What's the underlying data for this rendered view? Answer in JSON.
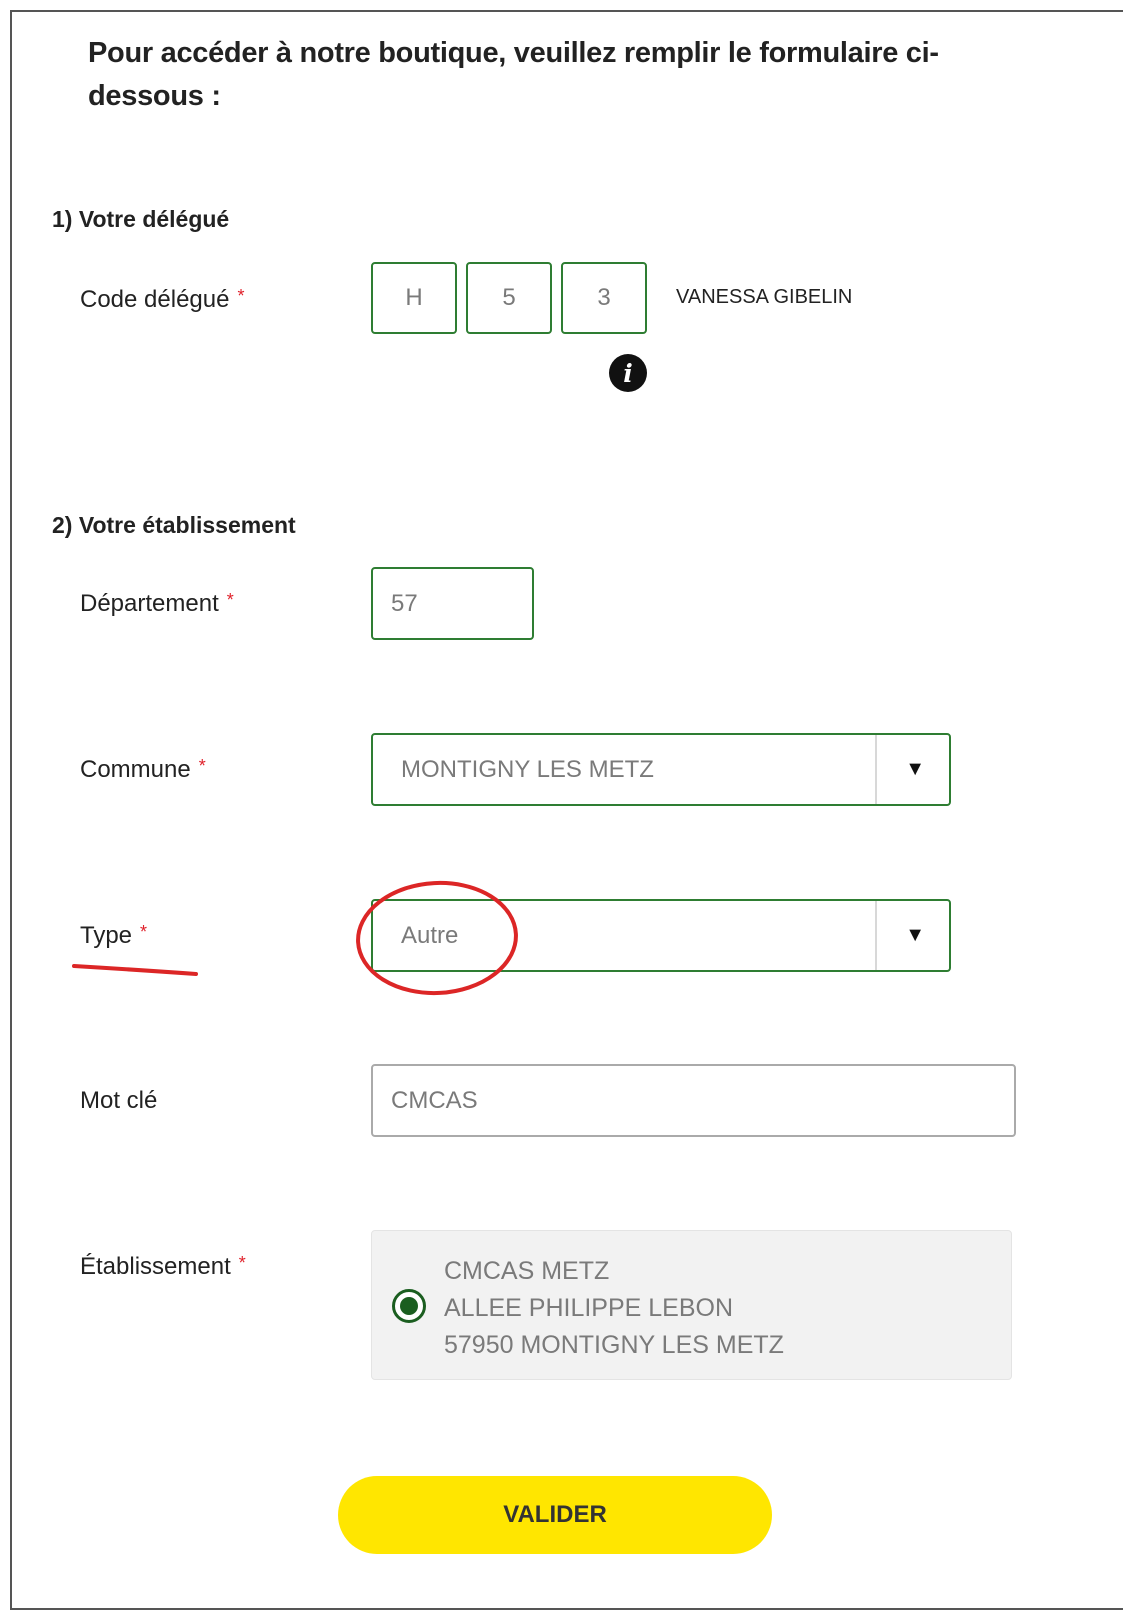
{
  "intro_text": "Pour accéder à notre boutique, veuillez remplir le formulaire ci-dessous :",
  "section1": {
    "title": "1) Votre délégué"
  },
  "delegate": {
    "label": "Code délégué",
    "required_mark": "*",
    "code_chars": [
      "H",
      "5",
      "3"
    ],
    "name": "VANESSA GIBELIN",
    "info_icon": "i"
  },
  "section2": {
    "title": "2) Votre établissement"
  },
  "departement": {
    "label": "Département",
    "required_mark": "*",
    "value": "57"
  },
  "commune": {
    "label": "Commune",
    "required_mark": "*",
    "value": "MONTIGNY LES METZ",
    "chevron": "▼"
  },
  "type": {
    "label": "Type",
    "required_mark": "*",
    "value": "Autre",
    "chevron": "▼"
  },
  "mot_cle": {
    "label": "Mot clé",
    "value": "CMCAS"
  },
  "etablissement": {
    "label": "Établissement",
    "required_mark": "*",
    "option_lines": [
      "CMCAS METZ",
      "ALLEE PHILIPPE LEBON",
      "57950 MONTIGNY LES METZ"
    ]
  },
  "submit": {
    "label": "VALIDER"
  },
  "colors": {
    "accent_green": "#2e7d32",
    "button_yellow": "#ffe600",
    "required_red": "#e0202a",
    "annotation_red": "#dc2626"
  }
}
